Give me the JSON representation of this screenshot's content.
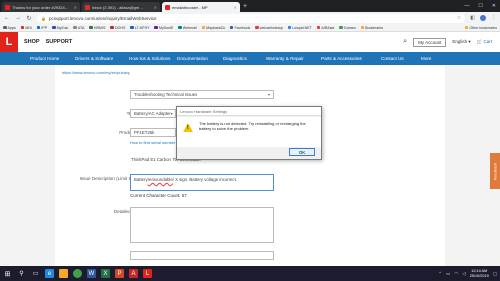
{
  "browser": {
    "tabs": [
      {
        "title": "Thanks for your order #29324…",
        "color": "#e2231a",
        "active": false
      },
      {
        "title": "Inbox (2,391) - aliasa@gm…",
        "color": "#d93025",
        "active": false
      },
      {
        "title": "emailathoosier - MP",
        "color": "#e2231a",
        "active": true
      }
    ],
    "new_tab": "+",
    "window_controls": [
      "—",
      "☐",
      "✕"
    ],
    "url": "pcsupport.lenovo.com/us/en/inquiry/EmailWebService",
    "bookmarks": [
      {
        "label": "Apps",
        "color": "#5f6368"
      },
      {
        "label": "MDI",
        "color": "#e2231a"
      },
      {
        "label": "IPP",
        "color": "#1565c0"
      },
      {
        "label": "MyZulu",
        "color": "#3949ab"
      },
      {
        "label": "ATA",
        "color": "#888"
      },
      {
        "label": "HRMIS",
        "color": "#2e7d32"
      },
      {
        "label": "DOHS",
        "color": "#c62828"
      },
      {
        "label": "LT-KPSY",
        "color": "#1565c0"
      },
      {
        "label": "MySoniE",
        "color": "#6a1b9a"
      },
      {
        "label": "Webmail",
        "color": "#00838f"
      },
      {
        "label": "MaybankZu",
        "color": "#f9a825"
      },
      {
        "label": "Facebook",
        "color": "#3b5998"
      },
      {
        "label": "welcaehotstop",
        "color": "#e53935"
      },
      {
        "label": "Lowyat.NET",
        "color": "#1e88e5"
      },
      {
        "label": "AIRAsia",
        "color": "#e53935"
      },
      {
        "label": "Gobam",
        "color": "#43a047"
      },
      {
        "label": "Bookmarks",
        "color": "#f9a825"
      }
    ],
    "other_bookmarks": "Other bookmarks"
  },
  "header": {
    "logo_text": "L",
    "shop": "SHOP",
    "support": "SUPPORT",
    "my_account": "My Account",
    "language": "English",
    "cart": "Cart"
  },
  "nav": [
    "Product Home",
    "Drivers & Software",
    "How-tos & Solutions",
    "Documentation",
    "Diagnostics",
    "Warranty & Repair",
    "Parts & Accessories",
    "Contact Us",
    "More"
  ],
  "form": {
    "privacy_link": "https://www.lenovo.com/my/en/privacy",
    "inquiry_label": "Inquiry Options: *",
    "inquiry_value": "Troubleshooting Technical Issues",
    "category_label": "Technical Category: *",
    "category_value": "Battery/AC Adapter",
    "serial_label": "Product Serial Number: *",
    "serial_value": "PF1ET26k",
    "serial_help": "How to find serial number",
    "machine_label": "Machine Type: *",
    "machine_value": "ThinkPad E1 Carbon 7th Generation",
    "desc_label": "Issue Description (Limit to 200 characters): *",
    "desc_value_pre": "Battery ",
    "desc_value_err": "remoundable",
    "desc_value_post": "/ X sign. Battery voltage incorrect.",
    "char_count": "Current Character Count: 57",
    "steps_label": "Detailed steps to reproduce the issues: *",
    "first_name_label": "First Name: *"
  },
  "dialog": {
    "title": "Lenovo Hardware Settings",
    "message": "The battery is not detected. Try reinstalling or recharging the battery to solve the problem.",
    "ok": "OK"
  },
  "feedback": "Feedback",
  "taskbar": {
    "time": "12:14 AM",
    "date": "25/10/2019"
  }
}
